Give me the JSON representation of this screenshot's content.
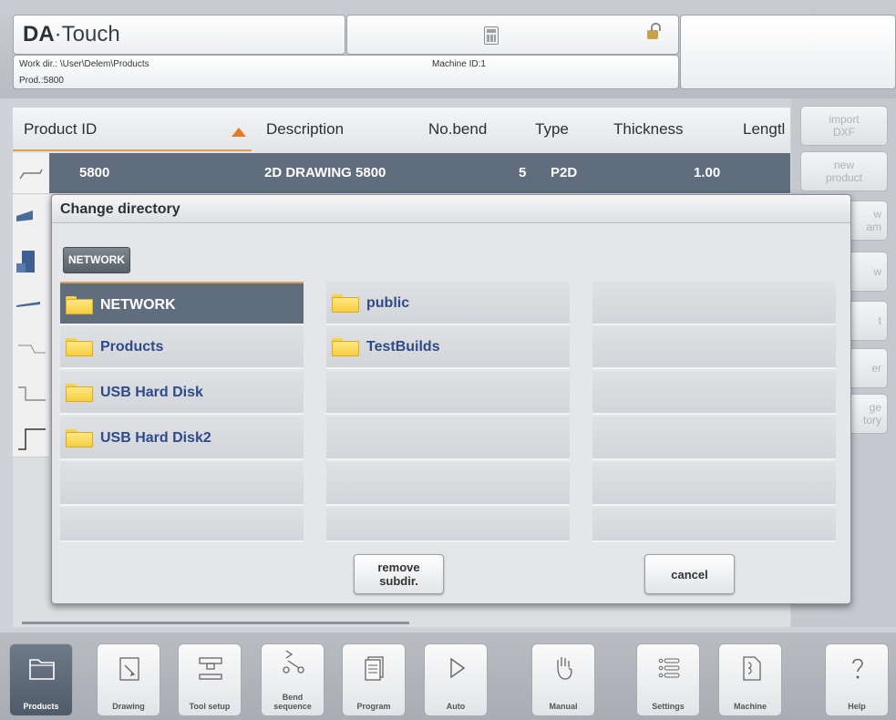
{
  "header": {
    "brand_bold": "DA",
    "brand_rest": "·Touch",
    "work_dir": "Work dir.: \\User\\Delem\\Products",
    "prod": "Prod.:5800",
    "machine_id": "Machine ID:1",
    "calculator_icon": "calculator-icon",
    "lock_icon": "unlocked-padlock-icon"
  },
  "table": {
    "columns": [
      "Product ID",
      "Description",
      "No.bend",
      "Type",
      "Thickness",
      "Lengtl"
    ],
    "sort_icon": "sort-ascending-icon",
    "selected_row": {
      "product_id": "5800",
      "description": "2D DRAWING 5800",
      "no_bend": "5",
      "type": "P2D",
      "thickness": "1.00"
    }
  },
  "side_buttons": [
    {
      "label_1": "import",
      "label_2": "DXF"
    },
    {
      "label_1": "new",
      "label_2": "product"
    },
    {
      "label_1": "w",
      "label_2": "am"
    },
    {
      "label_1": "w",
      "label_2": ""
    },
    {
      "label_1": "t",
      "label_2": ""
    },
    {
      "label_1": "er",
      "label_2": ""
    },
    {
      "label_1": "ge",
      "label_2": "tory"
    }
  ],
  "dialog": {
    "title": "Change directory",
    "breadcrumb": "NETWORK",
    "col1": [
      "NETWORK",
      "Products",
      "USB Hard Disk",
      "USB Hard Disk2"
    ],
    "col2": [
      "public",
      "TestBuilds"
    ],
    "remove_1": "remove",
    "remove_2": "subdir.",
    "cancel": "cancel"
  },
  "bottom_nav": [
    {
      "label": "Products",
      "icon": "folder-icon",
      "active": true
    },
    {
      "label": "Drawing",
      "icon": "pencil-drawing-icon"
    },
    {
      "label": "Tool setup",
      "icon": "press-tool-icon"
    },
    {
      "label_1": "Bend",
      "label_2": "sequence",
      "icon": "bend-sequence-icon"
    },
    {
      "label": "Program",
      "icon": "pages-icon"
    },
    {
      "label": "Auto",
      "icon": "play-icon"
    },
    {
      "label": "Manual",
      "icon": "hand-icon"
    },
    {
      "label": "Settings",
      "icon": "list-settings-icon"
    },
    {
      "label": "Machine",
      "icon": "machine-document-icon"
    },
    {
      "label": "Help",
      "icon": "question-icon"
    }
  ]
}
